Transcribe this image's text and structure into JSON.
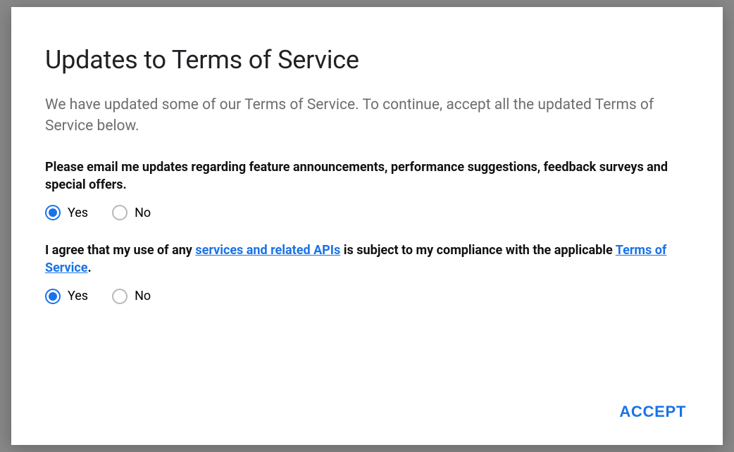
{
  "dialog": {
    "title": "Updates to Terms of Service",
    "subtitle": "We have updated some of our Terms of Service. To continue, accept all the updated Terms of Service below.",
    "sections": [
      {
        "text_plain": "Please email me updates regarding feature announcements, performance suggestions, feedback surveys and special offers.",
        "options": {
          "yes": "Yes",
          "no": "No"
        },
        "selected": "yes"
      },
      {
        "text_prefix": "I agree that my use of any ",
        "link1": "services and related APIs",
        "text_mid": " is subject to my compliance with the applicable ",
        "link2": "Terms of Service",
        "text_suffix": ".",
        "options": {
          "yes": "Yes",
          "no": "No"
        },
        "selected": "yes"
      }
    ],
    "accept_label": "ACCEPT"
  },
  "colors": {
    "accent": "#1a73e8",
    "text_muted": "#6d6d6d"
  }
}
